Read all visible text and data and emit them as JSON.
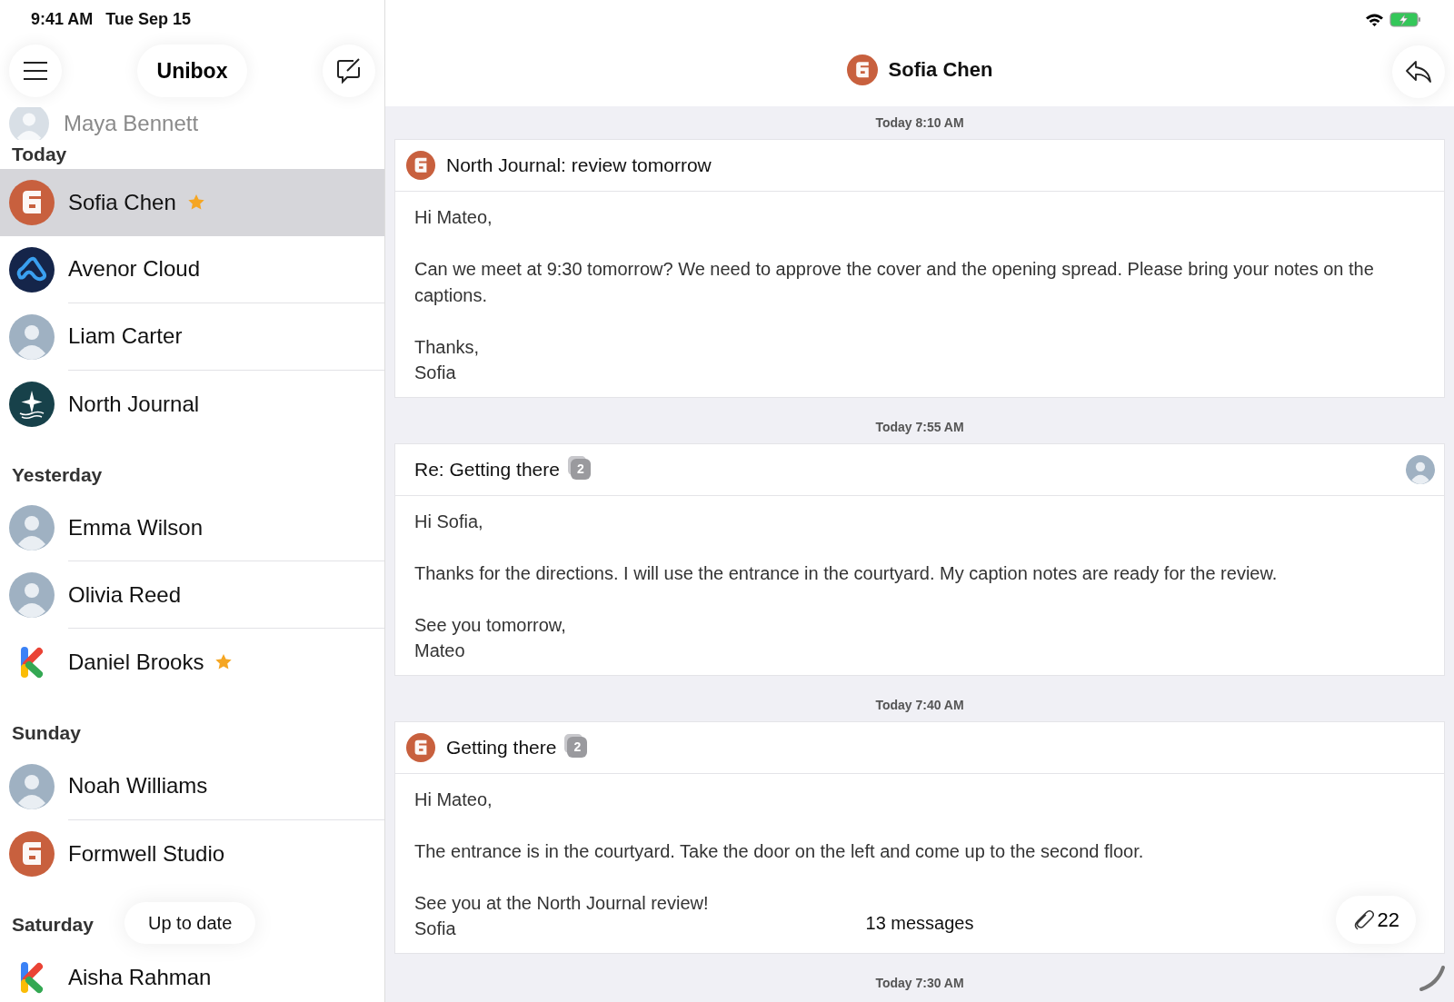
{
  "status_bar": {
    "time": "9:41 AM",
    "date": "Tue Sep 15",
    "wifi": true,
    "charging": true
  },
  "sidebar": {
    "title": "Unibox",
    "partial_row": {
      "name": "Maya Bennett",
      "kind": "person"
    },
    "groups": [
      {
        "label": "Today",
        "items": [
          {
            "name": "Sofia Chen",
            "kind": "fmark",
            "starred": true,
            "selected": true
          },
          {
            "name": "Avenor Cloud",
            "kind": "cloud",
            "starred": false,
            "selected": false
          },
          {
            "name": "Liam Carter",
            "kind": "person",
            "starred": false,
            "selected": false
          },
          {
            "name": "North Journal",
            "kind": "journal",
            "starred": false,
            "selected": false
          }
        ]
      },
      {
        "label": "Yesterday",
        "items": [
          {
            "name": "Emma Wilson",
            "kind": "person",
            "starred": false,
            "selected": false
          },
          {
            "name": "Olivia Reed",
            "kind": "person",
            "starred": false,
            "selected": false
          },
          {
            "name": "Daniel Brooks",
            "kind": "kmark",
            "starred": true,
            "selected": false
          }
        ]
      },
      {
        "label": "Sunday",
        "items": [
          {
            "name": "Noah Williams",
            "kind": "person",
            "starred": false,
            "selected": false
          },
          {
            "name": "Formwell Studio",
            "kind": "fmark",
            "starred": false,
            "selected": false
          }
        ]
      },
      {
        "label": "Saturday",
        "items": [
          {
            "name": "Aisha Rahman",
            "kind": "kmark",
            "starred": false,
            "selected": false
          }
        ]
      }
    ],
    "toast": "Up to date"
  },
  "conversation": {
    "title": "Sofia Chen",
    "kind": "fmark",
    "messages": [
      {
        "time": "Today 8:10 AM",
        "subject": "North Journal: review tomorrow",
        "kind": "fmark",
        "from_me": false,
        "paragraphs": [
          [
            "Hi Mateo,"
          ],
          [
            "Can we meet at 9:30 tomorrow? We need to approve the cover and the opening spread. Please bring your notes on the captions."
          ],
          [
            "Thanks,",
            "Sofia"
          ]
        ]
      },
      {
        "time": "Today 7:55 AM",
        "subject": "Re: Getting there",
        "thread_count": "2",
        "kind": "person",
        "from_me": true,
        "paragraphs": [
          [
            "Hi Sofia,"
          ],
          [
            "Thanks for the directions. I will use the entrance in the courtyard. My caption notes are ready for the review."
          ],
          [
            "See you tomorrow,",
            "Mateo"
          ]
        ]
      },
      {
        "time": "Today 7:40 AM",
        "subject": "Getting there",
        "thread_count": "2",
        "kind": "fmark",
        "from_me": false,
        "paragraphs": [
          [
            "Hi Mateo,"
          ],
          [
            "The entrance is in the courtyard. Take the door on the left and come up to the second floor."
          ],
          [
            "See you at the North Journal review!",
            "Sofia"
          ]
        ]
      }
    ],
    "next_time": "Today 7:30 AM",
    "message_count": "13 messages",
    "attachments": "22"
  }
}
